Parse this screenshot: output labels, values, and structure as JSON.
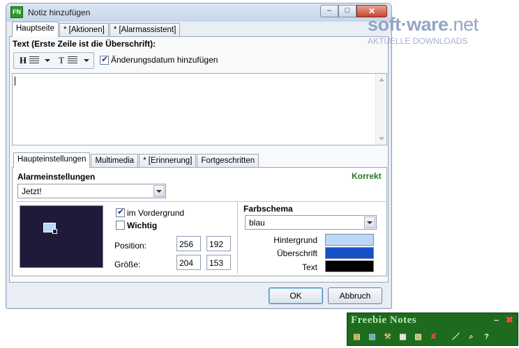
{
  "window": {
    "title": "Notiz hinzufügen",
    "app_icon_text": "FN",
    "controls": {
      "minimize": "–",
      "maximize": "□",
      "close": "✕"
    }
  },
  "top_tabs": [
    "Hauptseite",
    "* [Aktionen]",
    "* [Alarmassistent]"
  ],
  "text_section": {
    "label": "Text (Erste Zeile ist die Überschrift):",
    "heading_format_label": "H",
    "text_format_label": "T",
    "add_date_checkbox": {
      "label": "Änderungsdatum hinzufügen",
      "checked": true
    },
    "content": ""
  },
  "bottom_tabs": [
    "Haupteinstellungen",
    "Multimedia",
    "* [Erinnerung]",
    "Fortgeschritten"
  ],
  "alarm": {
    "label": "Alarmeinstellungen",
    "status": "Korrekt",
    "status_color": "#1f7a1f",
    "selected": "Jetzt!"
  },
  "appearance": {
    "foreground_checkbox": {
      "label": "im Vordergrund",
      "checked": true
    },
    "important_checkbox": {
      "label": "Wichtig",
      "checked": false
    },
    "position_label": "Position:",
    "position_values": [
      "256",
      "192"
    ],
    "size_label": "Größe:",
    "size_values": [
      "204",
      "153"
    ]
  },
  "color_scheme": {
    "label": "Farbschema",
    "selected": "blau",
    "rows": [
      {
        "label": "Hintergrund",
        "color": "#bcd8f8"
      },
      {
        "label": "Überschrift",
        "color": "#1450c8"
      },
      {
        "label": "Text",
        "color": "#000000"
      }
    ]
  },
  "buttons": {
    "ok": "OK",
    "cancel": "Abbruch"
  },
  "watermark": {
    "brand_a": "soft",
    "brand_b": "ware",
    "brand_c": ".net",
    "tagline": "AKTUELLE DOWNLOADS"
  },
  "freebie_bar": {
    "title": "Freebie Notes",
    "minimize": "–",
    "close": "✖",
    "icons": [
      "notes-list-icon",
      "new-note-icon",
      "tools-icon",
      "calendar-icon",
      "clipboard-icon",
      "delete-note-icon",
      "pen-icon",
      "search-icon",
      "help-icon"
    ],
    "icon_glyphs": [
      "▤",
      "▥",
      "⚒",
      "▦",
      "▧",
      "✘",
      "／",
      "⌕",
      "?"
    ]
  }
}
